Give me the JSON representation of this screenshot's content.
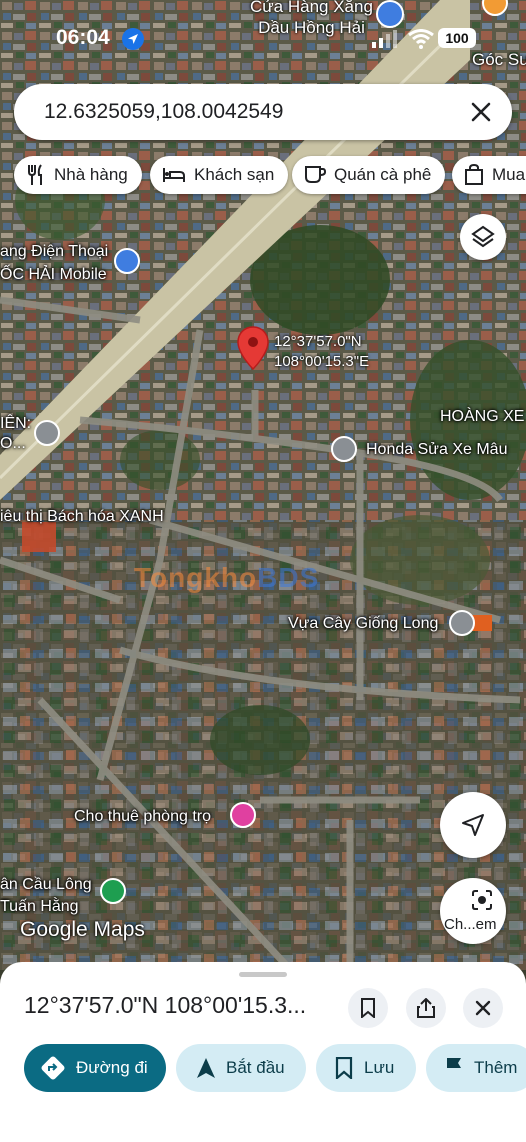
{
  "status_bar": {
    "time": "06:04",
    "battery": "100"
  },
  "search": {
    "query": "12.6325059,108.0042549"
  },
  "chips": [
    {
      "label": "Nhà hàng",
      "icon": "restaurant-icon"
    },
    {
      "label": "Khách sạn",
      "icon": "hotel-icon"
    },
    {
      "label": "Quán cà phê",
      "icon": "coffee-icon"
    },
    {
      "label": "Mua",
      "icon": "shopping-bag-icon"
    }
  ],
  "map_labels": {
    "gas_station": "Cửa Hàng Xăng\nDầu Hồng Hải",
    "goc_su": "Góc Su",
    "phone_shop": "ang Điện Thoại\nỐC HẢI Mobile",
    "school": "IÊN:\nO...",
    "pin_coords": "12°37'57.0\"N\n108°00'15.3\"E",
    "hoang_xe": "HOÀNG XE",
    "honda": "Honda Sửa Xe Mâu",
    "bach_hoa": "iêu thị Bách hóa XANH",
    "vua_cay": "Vựa Cây Giống Long",
    "phong_tro": "Cho thuê phòng trọ",
    "cau_long": "ân Cầu Lông\nTuấn Hằng",
    "google_maps": "Google Maps",
    "watermark_a": "Tongkho",
    "watermark_b": "BDS"
  },
  "lens_label": "Ch...em",
  "sheet": {
    "title": "12°37'57.0\"N 108°00'15.3...",
    "actions": [
      {
        "label": "Đường đi"
      },
      {
        "label": "Bắt đầu"
      },
      {
        "label": "Lưu"
      },
      {
        "label": "Thêm"
      }
    ]
  },
  "colors": {
    "pin_red": "#e53935",
    "primary_button": "#0b6b83",
    "secondary_button": "#d4ecf4",
    "poi_gray": "#8a8f94",
    "poi_blue": "#3f7de0",
    "poi_pink": "#e040a0",
    "poi_green": "#1e9e50"
  }
}
